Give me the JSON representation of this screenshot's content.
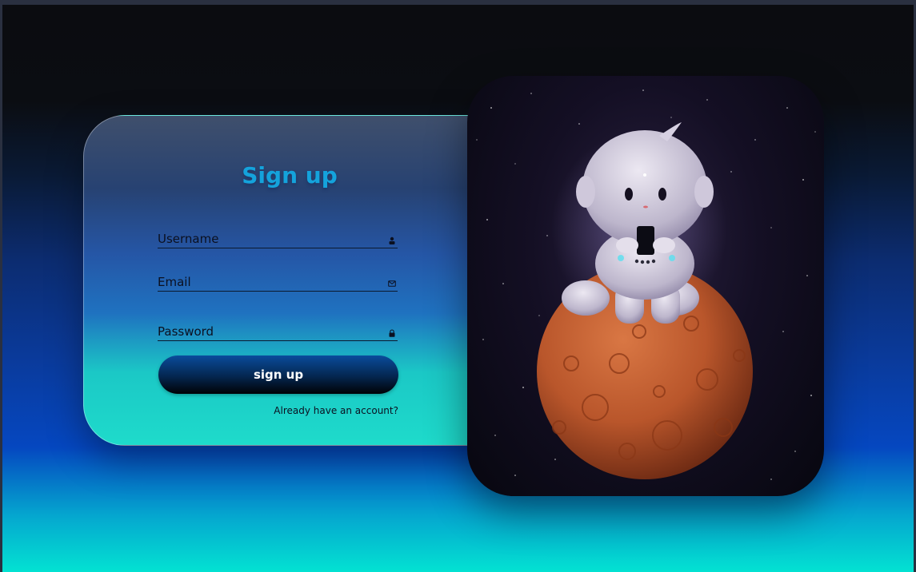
{
  "form": {
    "title": "Sign up",
    "fields": [
      {
        "label": "Username",
        "icon": "user-icon"
      },
      {
        "label": "Email",
        "icon": "mail-icon"
      },
      {
        "label": "Password",
        "icon": "lock-icon"
      }
    ],
    "submit_label": "sign up",
    "login_link": "Already have an account?"
  },
  "colors": {
    "title": "#14a3dc",
    "button_top": "#0a4c9c",
    "button_bottom": "#000205",
    "planet": "#c0582c"
  }
}
